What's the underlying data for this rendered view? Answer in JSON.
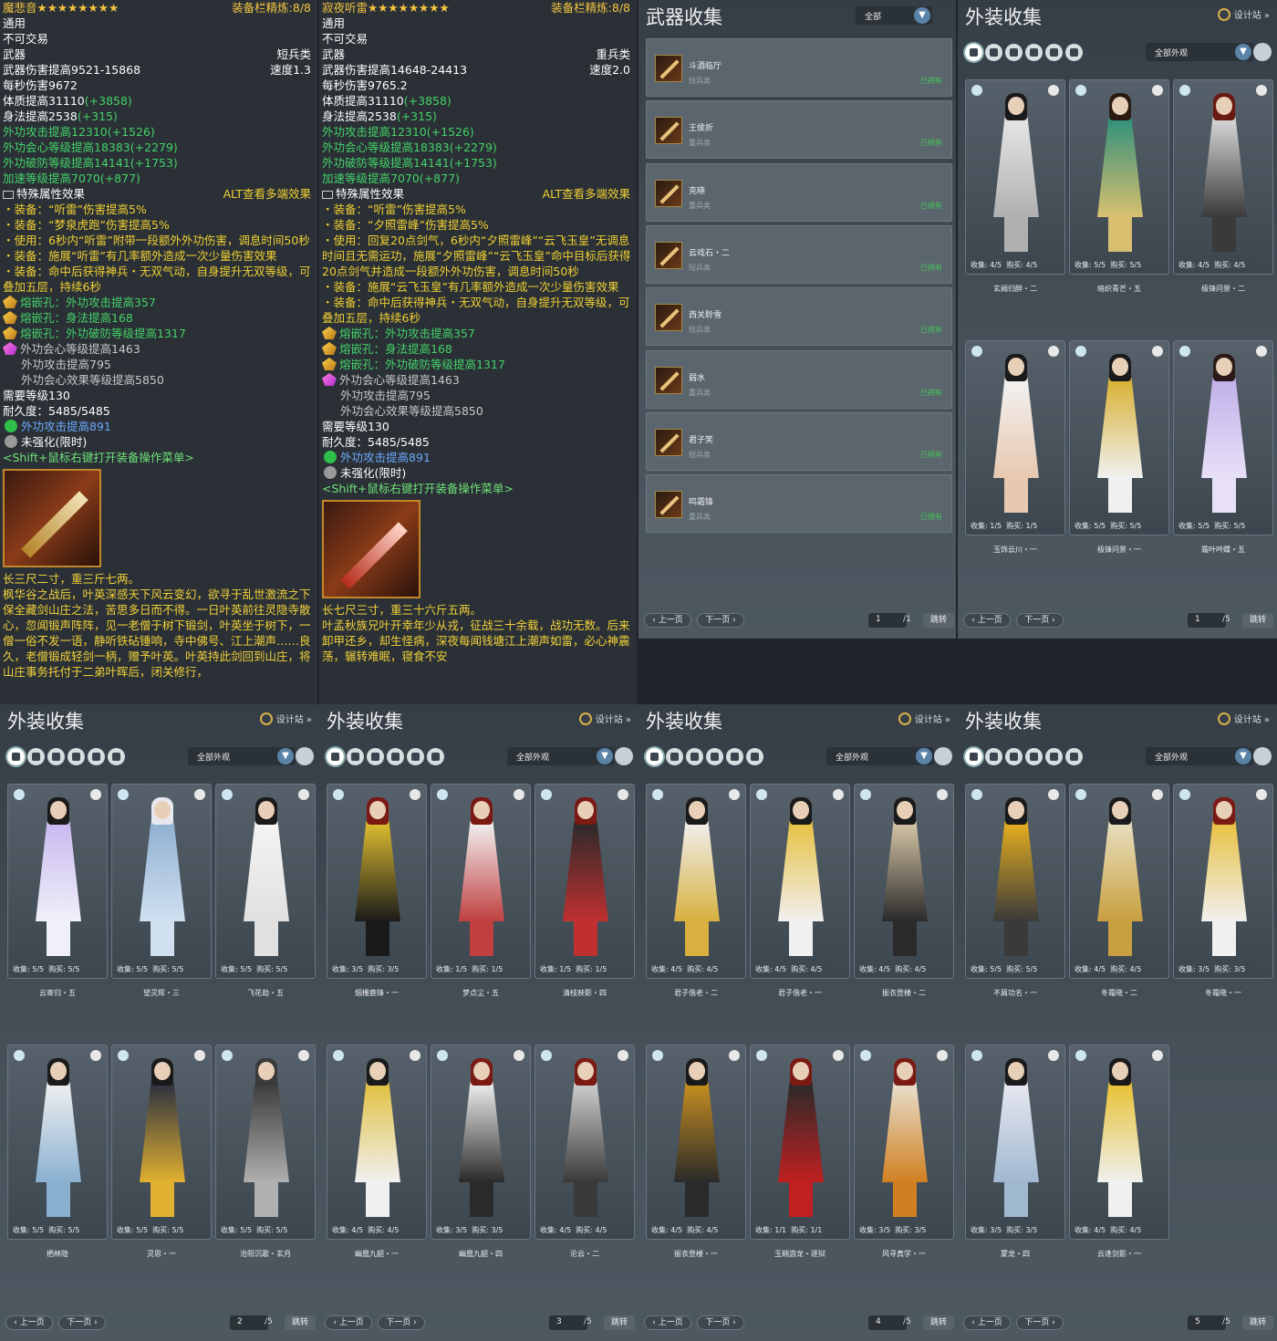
{
  "tooltips": [
    {
      "name": "魔悲音",
      "stars": "★★★★★★★★",
      "refine": "装备栏精炼:8/8",
      "watermark": "www.91yxs.com爱剑三",
      "lines": [
        {
          "t": "通用",
          "c": "w"
        },
        {
          "t": "不可交易",
          "c": "w"
        },
        {
          "t": "武器",
          "c": "w",
          "r": "短兵类"
        },
        {
          "t": "武器伤害提高9521-15868",
          "c": "w",
          "r": "速度1.3"
        },
        {
          "t": "每秒伤害9672",
          "c": "w"
        },
        {
          "t": "体质提高31110",
          "g": "(+3858)",
          "c": "w"
        },
        {
          "t": "身法提高2538",
          "g": "(+315)",
          "c": "w"
        },
        {
          "t": "外功攻击提高12310(+1526)",
          "c": "green"
        },
        {
          "t": "外功会心等级提高18383(+2279)",
          "c": "green"
        },
        {
          "t": "外功破防等级提高14141(+1753)",
          "c": "green"
        },
        {
          "t": "加速等级提高7070(+877)",
          "c": "green"
        },
        {
          "t": "特殊属性效果",
          "c": "yw",
          "r": "ALT查看多端效果",
          "rc": "yellow"
        },
        {
          "t": "・装备：“听雷”伤害提高5%",
          "c": "yellow"
        },
        {
          "t": "・装备：“梦泉虎跑”伤害提高5%",
          "c": "yellow"
        },
        {
          "t": "・使用：6秒内“听雷”附带一段额外外功伤害，调息时间50秒",
          "c": "yellow",
          "wrap": true
        },
        {
          "t": "・装备：施展“听雷”有几率额外造成一次少量伤害效果",
          "c": "yellow"
        },
        {
          "t": "・装备：命中后获得神兵・无双气动，自身提升无双等级，可叠加五层，持续6秒",
          "c": "yellow",
          "wrap": true
        },
        {
          "t": "熔嵌孔：外功攻击提高357",
          "c": "green",
          "gem": "g"
        },
        {
          "t": "熔嵌孔：身法提高168",
          "c": "green",
          "gem": "g"
        },
        {
          "t": "熔嵌孔：外功破防等级提高1317",
          "c": "green",
          "gem": "g"
        },
        {
          "t": "外功会心等级提高1463",
          "c": "grey",
          "gem": "p"
        },
        {
          "t": "外功攻击提高795",
          "c": "grey",
          "ind": true
        },
        {
          "t": "外功会心效果等级提高5850",
          "c": "grey",
          "ind": true
        },
        {
          "t": "需要等级130",
          "c": "w"
        },
        {
          "t": "耐久度：5485/5485",
          "c": "w"
        },
        {
          "t": "外功攻击提高891",
          "c": "blue",
          "ci": "g"
        },
        {
          "t": "未强化(限时)",
          "c": "w",
          "ci": "x"
        },
        {
          "t": "<Shift+鼠标右键打开装备操作菜单>",
          "c": "lgreen"
        }
      ],
      "story": "长三尺二寸，重三斤七两。\n枫华谷之战后，叶英深感天下风云变幻，欲寻于乱世激流之下保全藏剑山庄之法，苦思多日而不得。一日叶英前往灵隐寺散心，忽闻锻声阵阵，见一老僧于树下锻剑，叶英坐于树下，一僧一俗不发一语，静听铁砧锤响，寺中佛号、江上潮声……良久，老僧锻成轻剑一柄，赠予叶英。叶英持此剑回到山庄，将山庄事务托付于二弟叶晖后，闭关修行，"
    },
    {
      "name": "寂夜听雷",
      "stars": "★★★★★★★★",
      "refine": "装备栏精炼:8/8",
      "watermark": "www.91yxs.com爱剑三",
      "lines": [
        {
          "t": "通用",
          "c": "w"
        },
        {
          "t": "不可交易",
          "c": "w"
        },
        {
          "t": "武器",
          "c": "w",
          "r": "重兵类"
        },
        {
          "t": "武器伤害提高14648-24413",
          "c": "w",
          "r": "速度2.0"
        },
        {
          "t": "每秒伤害9765.2",
          "c": "w"
        },
        {
          "t": "体质提高31110",
          "g": "(+3858)",
          "c": "w"
        },
        {
          "t": "身法提高2538",
          "g": "(+315)",
          "c": "w"
        },
        {
          "t": "外功攻击提高12310(+1526)",
          "c": "green"
        },
        {
          "t": "外功会心等级提高18383(+2279)",
          "c": "green"
        },
        {
          "t": "外功破防等级提高14141(+1753)",
          "c": "green"
        },
        {
          "t": "加速等级提高7070(+877)",
          "c": "green"
        },
        {
          "t": "特殊属性效果",
          "c": "yw",
          "r": "ALT查看多端效果",
          "rc": "yellow"
        },
        {
          "t": "・装备：“听雷”伤害提高5%",
          "c": "yellow"
        },
        {
          "t": "・装备：“夕照雷峰”伤害提高5%",
          "c": "yellow"
        },
        {
          "t": "・使用：回复20点剑气，6秒内“夕照雷峰”“云飞玉皇”无调息时间且无需运功，施展“夕照雷峰”“云飞玉皇”命中目标后获得20点剑气并造成一段额外外功伤害，调息时间50秒",
          "c": "yellow",
          "wrap": true
        },
        {
          "t": "・装备：施展“云飞玉皇”有几率额外造成一次少量伤害效果",
          "c": "yellow",
          "wrap": true
        },
        {
          "t": "・装备：命中后获得神兵・无双气动，自身提升无双等级，可叠加五层，持续6秒",
          "c": "yellow",
          "wrap": true
        },
        {
          "t": "熔嵌孔：外功攻击提高357",
          "c": "green",
          "gem": "g"
        },
        {
          "t": "熔嵌孔：身法提高168",
          "c": "green",
          "gem": "g"
        },
        {
          "t": "熔嵌孔：外功破防等级提高1317",
          "c": "green",
          "gem": "g"
        },
        {
          "t": "外功会心等级提高1463",
          "c": "grey",
          "gem": "p"
        },
        {
          "t": "外功攻击提高795",
          "c": "grey",
          "ind": true
        },
        {
          "t": "外功会心效果等级提高5850",
          "c": "grey",
          "ind": true
        },
        {
          "t": "需要等级130",
          "c": "w"
        },
        {
          "t": "耐久度：5485/5485",
          "c": "w"
        },
        {
          "t": "外功攻击提高891",
          "c": "blue",
          "ci": "g"
        },
        {
          "t": "未强化(限时)",
          "c": "w",
          "ci": "x"
        },
        {
          "t": "<Shift+鼠标右键打开装备操作菜单>",
          "c": "lgreen"
        }
      ],
      "story": "长七尺三寸，重三十六斤五两。\n叶孟秋族兄叶开幸年少从戎，征战三十余载，战功无数。后来卸甲还乡，却生怪病，深夜每闻钱塘江上潮声如雷，必心神震荡，辗转难眠，寝食不安"
    }
  ],
  "weapon_panel": {
    "title": "武器收集",
    "filter": "全部",
    "owned_label": "已拥有",
    "items": [
      {
        "name": "斗酒临厅",
        "type": "短兵类"
      },
      {
        "name": "王侯折",
        "type": "重兵类"
      },
      {
        "name": "克晓",
        "type": "重兵类"
      },
      {
        "name": "云戏石・二",
        "type": "短兵类"
      },
      {
        "name": "西关聆雪",
        "type": "短兵类"
      },
      {
        "name": "弱水",
        "type": "重兵类"
      },
      {
        "name": "君子笑",
        "type": "短兵类"
      },
      {
        "name": "鸣霜锋",
        "type": "重兵类"
      }
    ],
    "pager": {
      "prev": "上一页",
      "next": "下一页",
      "page": "1",
      "total": "/1",
      "jump": "跳转"
    }
  },
  "common": {
    "coll_title": "外装收集",
    "designer": "设计站",
    "filter": "全部外观",
    "collect_label": "收集:",
    "buy_label": "购买:",
    "prev": "上一页",
    "next": "下一页",
    "jump": "跳转"
  },
  "outfit_panels": [
    {
      "page": "1",
      "total": "/5",
      "cards": [
        {
          "name": "玄阙归醉・二",
          "collect": "4/5",
          "buy": "4/5",
          "hair": "#1a1a1a",
          "body": "#e6e6e6",
          "accent": "#b0b0b0"
        },
        {
          "name": "暗织青芒・五",
          "collect": "5/5",
          "buy": "5/5",
          "hair": "#2a1a12",
          "body": "#2f8f7a",
          "accent": "#d8c070"
        },
        {
          "name": "极锋问景・二",
          "collect": "4/5",
          "buy": "4/5",
          "hair": "#6a1a12",
          "body": "#dadada",
          "accent": "#3a3a3a"
        },
        {
          "name": "玉饰云川・一",
          "collect": "1/5",
          "buy": "1/5",
          "hair": "#1a1a1a",
          "body": "#f2f2f2",
          "accent": "#e8c8b0"
        },
        {
          "name": "极锋问景・一",
          "collect": "5/5",
          "buy": "5/5",
          "hair": "#1a1a1a",
          "body": "#d8b030",
          "accent": "#f0f0f0"
        },
        {
          "name": "霜叶吟蝶・五",
          "collect": "5/5",
          "buy": "5/5",
          "hair": "#2a1a1a",
          "body": "#c0b0e8",
          "accent": "#e8e0f8"
        }
      ]
    },
    {
      "page": "2",
      "total": "/5",
      "cards": [
        {
          "name": "云寄归・五",
          "collect": "5/5",
          "buy": "5/5",
          "hair": "#1a1a1a",
          "body": "#c8b8f0",
          "accent": "#f0f0f8"
        },
        {
          "name": "望灵辉・三",
          "collect": "5/5",
          "buy": "5/5",
          "hair": "#e8e8f0",
          "body": "#8fb0d0",
          "accent": "#d0e0f0"
        },
        {
          "name": "飞花劫・五",
          "collect": "5/5",
          "buy": "5/5",
          "hair": "#1a1a1a",
          "body": "#f4f4f4",
          "accent": "#e0e0e0"
        },
        {
          "name": "栖林隐",
          "collect": "5/5",
          "buy": "5/5",
          "hair": "#1a1a1a",
          "body": "#f0f0f0",
          "accent": "#8ab0d0"
        },
        {
          "name": "灵思・一",
          "collect": "5/5",
          "buy": "5/5",
          "hair": "#1a1a1a",
          "body": "#2a2f40",
          "accent": "#e0b030"
        },
        {
          "name": "沧阳沉歌・玄月",
          "collect": "5/5",
          "buy": "5/5",
          "hair": "#3a3a3a",
          "body": "#3a3a3a",
          "accent": "#b0b0b0"
        }
      ]
    },
    {
      "page": "3",
      "total": "/5",
      "cards": [
        {
          "name": "烟栅鹿锋・一",
          "collect": "3/5",
          "buy": "3/5",
          "hair": "#7a1a12",
          "body": "#e0c030",
          "accent": "#1a1a1a"
        },
        {
          "name": "梦点尘・五",
          "collect": "1/5",
          "buy": "1/5",
          "hair": "#7a1a12",
          "body": "#f2f2f2",
          "accent": "#c04040"
        },
        {
          "name": "清枝映影・四",
          "collect": "1/5",
          "buy": "1/5",
          "hair": "#7a1a12",
          "body": "#2a2a2a",
          "accent": "#c03030"
        },
        {
          "name": "幽凰九韶・一",
          "collect": "4/5",
          "buy": "4/5",
          "hair": "#1a1a1a",
          "body": "#e0c040",
          "accent": "#f0f0f0"
        },
        {
          "name": "幽凰九韶・四",
          "collect": "3/5",
          "buy": "3/5",
          "hair": "#7a1a12",
          "body": "#f0f0f0",
          "accent": "#2a2a2a"
        },
        {
          "name": "沦云・二",
          "collect": "4/5",
          "buy": "4/5",
          "hair": "#7a1a12",
          "body": "#d0d0d0",
          "accent": "#3a3a3a"
        }
      ]
    },
    {
      "page": "4",
      "total": "/5",
      "cards": [
        {
          "name": "君子偕老・二",
          "collect": "4/5",
          "buy": "4/5",
          "hair": "#1a1a1a",
          "body": "#f0f0f0",
          "accent": "#d8b040"
        },
        {
          "name": "君子偕老・一",
          "collect": "4/5",
          "buy": "4/5",
          "hair": "#1a1a1a",
          "body": "#e8c040",
          "accent": "#f0f0f0"
        },
        {
          "name": "振衣登楼・二",
          "collect": "4/5",
          "buy": "4/5",
          "hair": "#1a1a1a",
          "body": "#d8c8a8",
          "accent": "#2a2a2a"
        },
        {
          "name": "振衣登楼・一",
          "collect": "4/5",
          "buy": "4/5",
          "hair": "#1a1a1a",
          "body": "#c89020",
          "accent": "#2a2a2a"
        },
        {
          "name": "玉翱游龙・逐狱",
          "collect": "1/1",
          "buy": "1/1",
          "hair": "#7a1a12",
          "body": "#2a2a2a",
          "accent": "#c02020"
        },
        {
          "name": "风寻真学・一",
          "collect": "3/5",
          "buy": "3/5",
          "hair": "#7a1a12",
          "body": "#e8e0d0",
          "accent": "#d08020"
        }
      ]
    },
    {
      "page": "5",
      "total": "/5",
      "cards": [
        {
          "name": "不屑功名・一",
          "collect": "5/5",
          "buy": "5/5",
          "hair": "#1a1a1a",
          "body": "#e8b020",
          "accent": "#3a3a3a"
        },
        {
          "name": "冬霜晓・二",
          "collect": "4/5",
          "buy": "4/5",
          "hair": "#1a1a1a",
          "body": "#e8e0c0",
          "accent": "#c8a040"
        },
        {
          "name": "冬霜晓・一",
          "collect": "3/5",
          "buy": "3/5",
          "hair": "#7a1a12",
          "body": "#e8c040",
          "accent": "#f0f0f0"
        },
        {
          "name": "蒙龙・四",
          "collect": "3/5",
          "buy": "3/5",
          "hair": "#1a1a1a",
          "body": "#e8e8f0",
          "accent": "#a0b8d0"
        },
        {
          "name": "云逢剑影・一",
          "collect": "4/5",
          "buy": "4/5",
          "hair": "#1a1a1a",
          "body": "#e8c030",
          "accent": "#f0f0f0"
        }
      ]
    }
  ]
}
